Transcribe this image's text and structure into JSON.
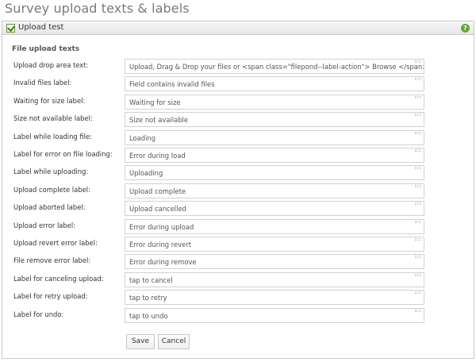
{
  "page": {
    "title": "Survey upload texts & labels"
  },
  "panel": {
    "title": "Upload test",
    "icon": "checkbox-icon",
    "help_icon": "help-icon",
    "help_glyph": "?"
  },
  "section": {
    "title": "File upload texts"
  },
  "fields": [
    {
      "label": "Upload drop area text:",
      "value": "Upload, Drag & Drop your files or <span class=\"filepond--label-action\"> Browse </span>"
    },
    {
      "label": "Invalid files label:",
      "value": "Field contains invalid files"
    },
    {
      "label": "Waiting for size label:",
      "value": "Waiting for size"
    },
    {
      "label": "Size not available label:",
      "value": "Size not available"
    },
    {
      "label": "Label while loading file:",
      "value": "Loading"
    },
    {
      "label": "Label for error on file loading:",
      "value": "Error during load"
    },
    {
      "label": "Label while uploading:",
      "value": "Uploading"
    },
    {
      "label": "Upload complete label:",
      "value": "Upload complete"
    },
    {
      "label": "Upload aborted label:",
      "value": "Upload cancelled"
    },
    {
      "label": "Upload error label:",
      "value": "Error during upload"
    },
    {
      "label": "Upload revert error label:",
      "value": "Error during revert"
    },
    {
      "label": "File remove error label:",
      "value": "Error during remove"
    },
    {
      "label": "Label for canceling upload:",
      "value": "tap to cancel"
    },
    {
      "label": "Label for retry upload:",
      "value": "tap to retry"
    },
    {
      "label": "Label for undo:",
      "value": "tap to undo"
    }
  ],
  "buttons": {
    "save": "Save",
    "cancel": "Cancel"
  }
}
